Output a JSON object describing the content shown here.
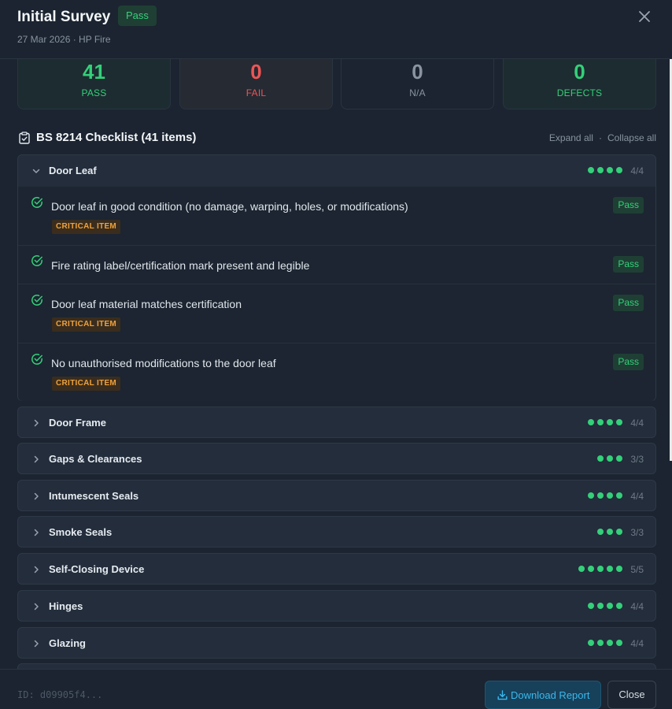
{
  "header": {
    "title": "Initial Survey",
    "status": "Pass",
    "subtitle": "27 Mar 2026 · HP Fire",
    "close_icon": "close-icon"
  },
  "stats": [
    {
      "value": "41",
      "label": "PASS",
      "color": "#34d07a"
    },
    {
      "value": "0",
      "label": "FAIL",
      "color": "#ee5555"
    },
    {
      "value": "0",
      "label": "N/A",
      "color": "#8a94a0"
    },
    {
      "value": "0",
      "label": "DEFECTS",
      "color": "#34d07a"
    }
  ],
  "checklist": {
    "title": "BS 8214 Checklist (41 items)",
    "expand_all": "Expand all",
    "collapse_all": "Collapse all",
    "sections": [
      {
        "name": "Door Leaf",
        "count": "4/4",
        "dots": 4,
        "expanded": true,
        "items": [
          {
            "text": "Door leaf in good condition (no damage, warping, holes, or modifications)",
            "critical": "CRITICAL ITEM",
            "result": "Pass"
          },
          {
            "text": "Fire rating label/certification mark present and legible",
            "critical": "",
            "result": "Pass"
          },
          {
            "text": "Door leaf material matches certification",
            "critical": "CRITICAL ITEM",
            "result": "Pass"
          },
          {
            "text": "No unauthorised modifications to the door leaf",
            "critical": "CRITICAL ITEM",
            "result": "Pass"
          }
        ]
      },
      {
        "name": "Door Frame",
        "count": "4/4",
        "dots": 4,
        "expanded": false
      },
      {
        "name": "Gaps & Clearances",
        "count": "3/3",
        "dots": 3,
        "expanded": false
      },
      {
        "name": "Intumescent Seals",
        "count": "4/4",
        "dots": 4,
        "expanded": false
      },
      {
        "name": "Smoke Seals",
        "count": "3/3",
        "dots": 3,
        "expanded": false
      },
      {
        "name": "Self-Closing Device",
        "count": "5/5",
        "dots": 5,
        "expanded": false
      },
      {
        "name": "Hinges",
        "count": "4/4",
        "dots": 4,
        "expanded": false
      },
      {
        "name": "Glazing",
        "count": "4/4",
        "dots": 4,
        "expanded": false
      }
    ]
  },
  "footer": {
    "id": "ID: d09905f4...",
    "download_label": "Download Report",
    "close_label": "Close"
  }
}
